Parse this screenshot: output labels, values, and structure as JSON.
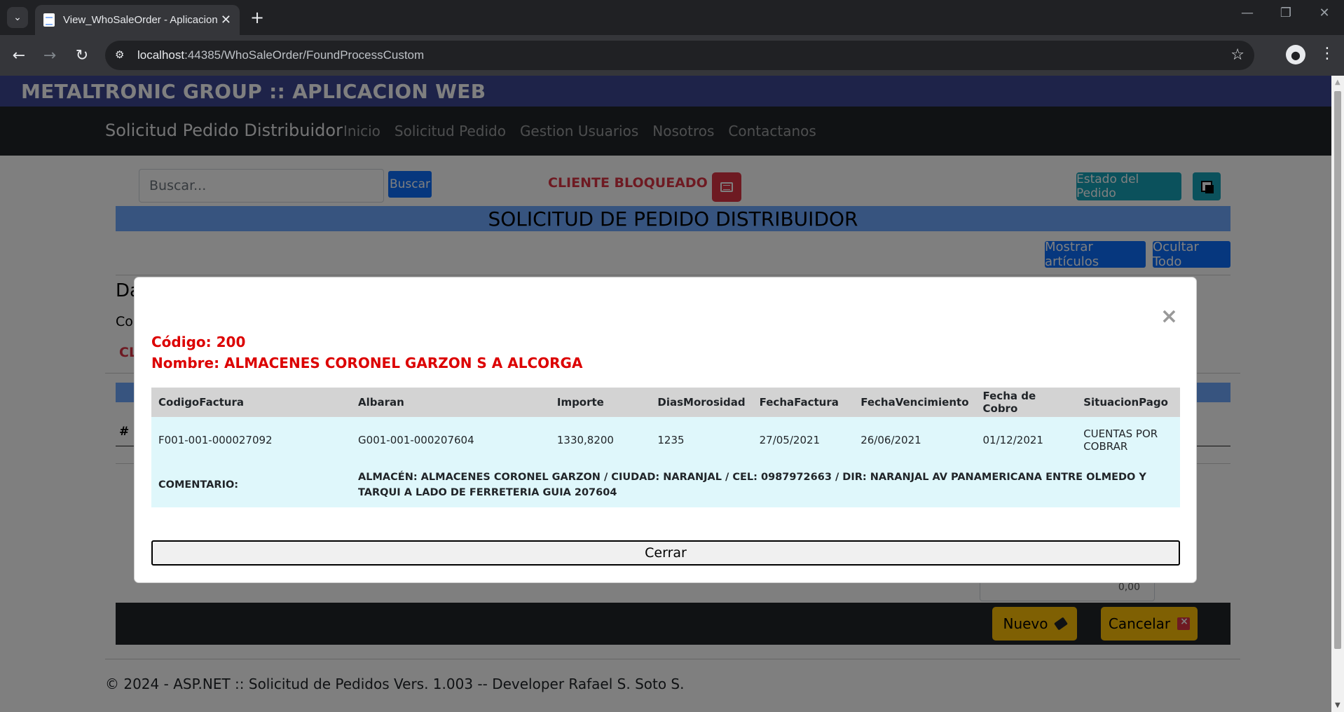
{
  "browser": {
    "tab_title": "View_WhoSaleOrder - Aplicacion",
    "url_host": "localhost",
    "url_path": ":44385/WhoSaleOrder/FoundProcessCustom"
  },
  "site": {
    "brand": "METALTRONIC GROUP :: APLICACION WEB",
    "app_name": "Solicitud Pedido Distribuidor",
    "nav": [
      "Inicio",
      "Solicitud Pedido",
      "Gestion Usuarios",
      "Nosotros",
      "Contactanos"
    ]
  },
  "toolbar": {
    "search_placeholder": "Buscar...",
    "search_button": "Buscar",
    "blocked_label": "CLIENTE BLOQUEADO",
    "estado_button": "Estado del Pedido"
  },
  "page": {
    "section_title": "SOLICITUD DE PEDIDO DISTRIBUIDOR",
    "mostrar_button": "Mostrar artículos",
    "ocultar_button": "Ocultar Todo",
    "partial_heading": "Da",
    "partial_label": "Co",
    "partial_red": "CL",
    "partial_hash": "#",
    "partial_value": "0,00",
    "nuevo_button": "Nuevo",
    "cancelar_button": "Cancelar",
    "footer": "© 2024 - ASP.NET :: Solicitud de Pedidos Vers. 1.003 -- Developer Rafael S. Soto S."
  },
  "modal": {
    "codigo": "Código: 200",
    "nombre": "Nombre: ALMACENES CORONEL GARZON S A ALCORGA",
    "columns": [
      "CodigoFactura",
      "Albaran",
      "Importe",
      "DiasMorosidad",
      "FechaFactura",
      "FechaVencimiento",
      "Fecha de Cobro",
      "SituacionPago"
    ],
    "row": {
      "codigo_factura": "F001-001-000027092",
      "albaran": "G001-001-000207604",
      "importe": "1330,8200",
      "dias_morosidad": "1235",
      "fecha_factura": "27/05/2021",
      "fecha_vencimiento": "26/06/2021",
      "fecha_cobro": "01/12/2021",
      "situacion_pago": "CUENTAS POR COBRAR"
    },
    "comment_label": "COMENTARIO:",
    "comment_text": "ALMACÉN: ALMACENES CORONEL GARZON / CIUDAD: NARANJAL / CEL: 0987972663 / DIR: NARANJAL AV PANAMERICANA ENTRE OLMEDO Y TARQUI A LADO DE FERRETERIA GUIA 207604",
    "close_button": "Cerrar"
  }
}
